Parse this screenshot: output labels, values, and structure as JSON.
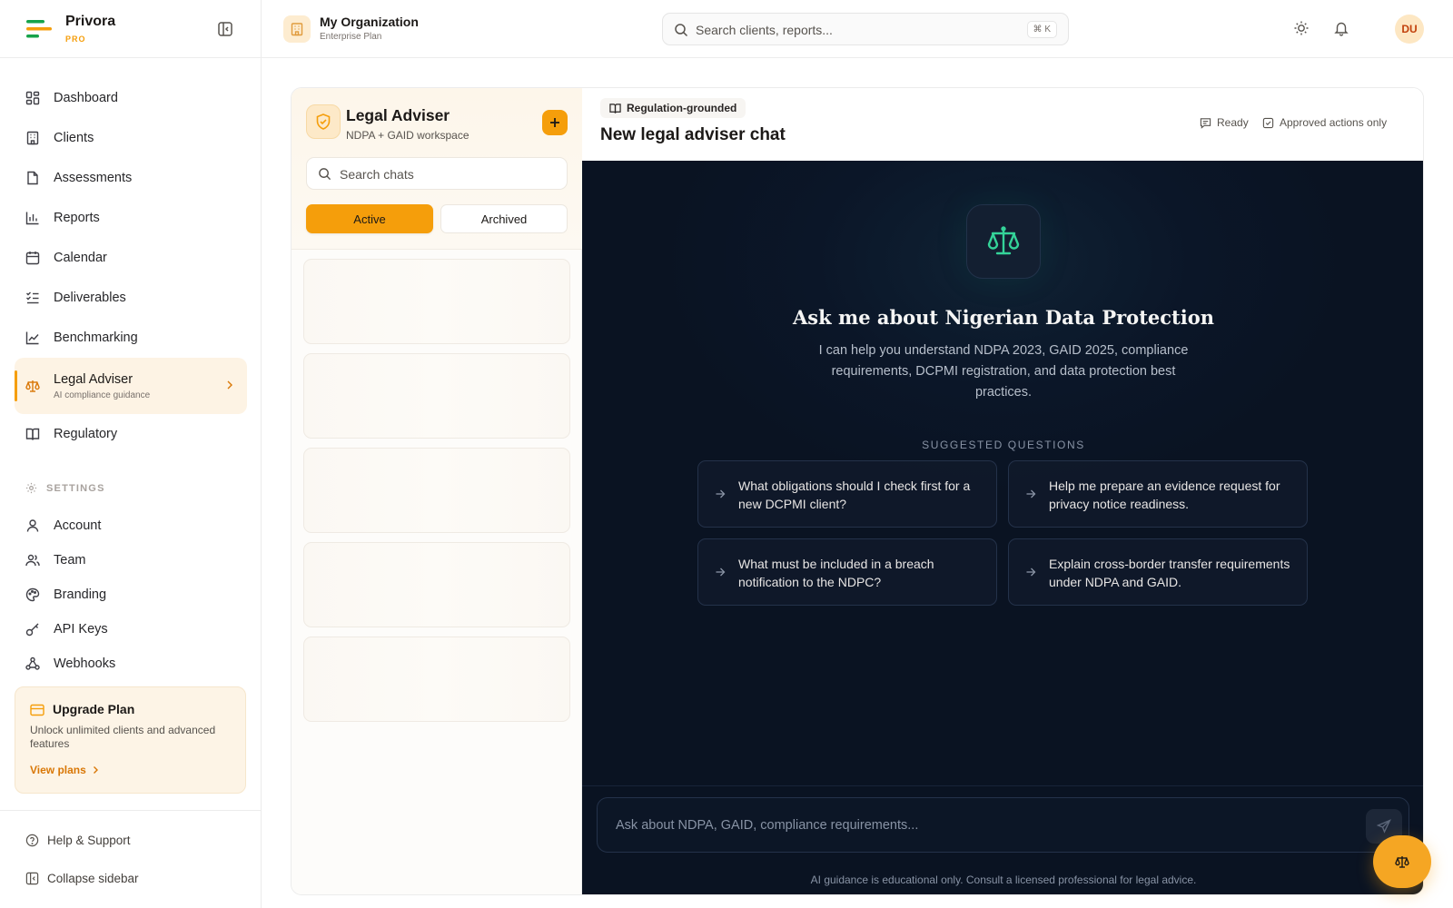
{
  "brand": {
    "name": "Privora",
    "tier": "PRO"
  },
  "sidebar": {
    "nav": [
      {
        "label": "Dashboard",
        "icon": "dashboard-icon"
      },
      {
        "label": "Clients",
        "icon": "building-icon"
      },
      {
        "label": "Assessments",
        "icon": "document-icon"
      },
      {
        "label": "Reports",
        "icon": "bar-chart-icon"
      },
      {
        "label": "Calendar",
        "icon": "calendar-icon"
      },
      {
        "label": "Deliverables",
        "icon": "checklist-icon"
      },
      {
        "label": "Benchmarking",
        "icon": "line-chart-icon"
      },
      {
        "label": "Legal Adviser",
        "sub": "AI compliance guidance",
        "icon": "scale-icon",
        "active": true
      },
      {
        "label": "Regulatory",
        "icon": "book-icon"
      }
    ],
    "settings_heading": "SETTINGS",
    "settings": [
      {
        "label": "Account",
        "icon": "user-icon"
      },
      {
        "label": "Team",
        "icon": "users-icon"
      },
      {
        "label": "Branding",
        "icon": "palette-icon"
      },
      {
        "label": "API Keys",
        "icon": "key-icon"
      },
      {
        "label": "Webhooks",
        "icon": "webhook-icon"
      }
    ],
    "upgrade": {
      "title": "Upgrade Plan",
      "description": "Unlock unlimited clients and advanced features",
      "link": "View plans"
    },
    "footer": {
      "help": "Help & Support",
      "collapse": "Collapse sidebar"
    }
  },
  "topbar": {
    "org_name": "My Organization",
    "org_plan": "Enterprise Plan",
    "search_placeholder": "Search clients, reports...",
    "shortcut": "⌘ K",
    "avatar_initials": "DU"
  },
  "chatlist": {
    "title": "Legal Adviser",
    "subtitle": "NDPA + GAID workspace",
    "search_placeholder": "Search chats",
    "tabs": [
      {
        "label": "Active",
        "active": true
      },
      {
        "label": "Archived",
        "active": false
      }
    ],
    "loading_items": 5
  },
  "chat": {
    "chip": "Regulation-grounded",
    "title": "New legal adviser chat",
    "status_ready": "Ready",
    "status_approved": "Approved actions only",
    "hero_title": "Ask me about Nigerian Data Protection",
    "hero_text": "I can help you understand NDPA 2023, GAID 2025, compliance requirements, DCPMI registration, and data protection best practices.",
    "suggestions_heading": "SUGGESTED QUESTIONS",
    "suggestions": [
      "What obligations should I check first for a new DCPMI client?",
      "Help me prepare an evidence request for privacy notice readiness.",
      "What must be included in a breach notification to the NDPC?",
      "Explain cross-border transfer requirements under NDPA and GAID."
    ],
    "composer_placeholder": "Ask about NDPA, GAID, compliance requirements...",
    "disclaimer": "AI guidance is educational only. Consult a licensed professional for legal advice."
  },
  "colors": {
    "accent": "#f59e0b",
    "dark_panel": "#0b1628",
    "emerald": "#34d399"
  }
}
